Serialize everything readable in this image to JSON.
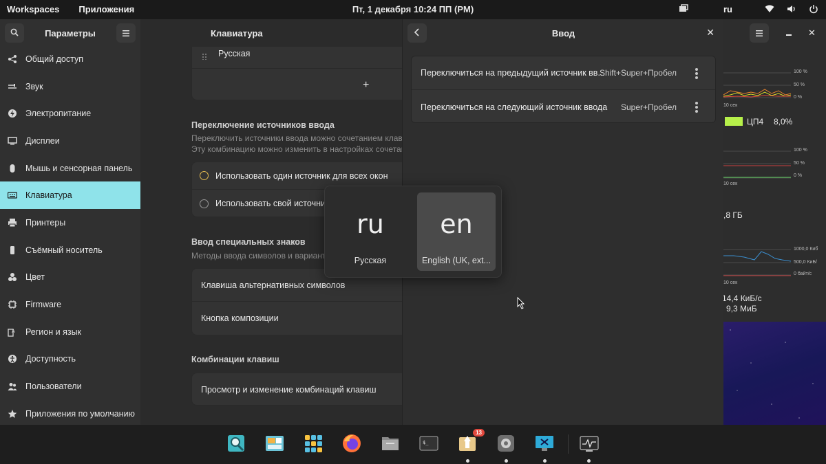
{
  "topbar": {
    "workspaces": "Workspaces",
    "applications": "Приложения",
    "datetime": "Пт, 1 декабря  10:24 ПП (PM)",
    "keyboard_layout": "ru"
  },
  "settings": {
    "sidebar_title": "Параметры",
    "main_title": "Клавиатура",
    "sidebar_items": [
      {
        "label": "Общий доступ",
        "icon": "share-icon"
      },
      {
        "label": "Звук",
        "icon": "sound-icon"
      },
      {
        "label": "Электропитание",
        "icon": "power-icon"
      },
      {
        "label": "Дисплеи",
        "icon": "display-icon"
      },
      {
        "label": "Мышь и сенсорная панель",
        "icon": "mouse-icon"
      },
      {
        "label": "Клавиатура",
        "icon": "keyboard-icon",
        "active": true
      },
      {
        "label": "Принтеры",
        "icon": "printer-icon"
      },
      {
        "label": "Съёмный носитель",
        "icon": "usb-icon"
      },
      {
        "label": "Цвет",
        "icon": "color-icon"
      },
      {
        "label": "Firmware",
        "icon": "chip-icon"
      },
      {
        "label": "Регион и язык",
        "icon": "region-icon"
      },
      {
        "label": "Доступность",
        "icon": "accessibility-icon"
      },
      {
        "label": "Пользователи",
        "icon": "users-icon"
      },
      {
        "label": "Приложения по умолчанию",
        "icon": "star-icon"
      }
    ],
    "input_sources": {
      "current": "Русская",
      "add_label": "+"
    },
    "switching": {
      "title": "Переключение источников ввода",
      "sub1": "Переключить источники ввода можно сочетанием клавиш",
      "sub2": "Эту комбинацию можно изменить в настройках сочетаний",
      "option1": "Использовать один источник для всех окон",
      "option2": "Использовать свой источник для каждого окна"
    },
    "special": {
      "title": "Ввод специальных знаков",
      "sub": "Методы ввода символов и вариантов букв с помощью клавиатуры",
      "row1": "Клавиша альтернативных символов",
      "row2": "Кнопка композиции"
    },
    "shortcuts": {
      "title": "Комбинации клавиш",
      "row1": "Просмотр и изменение комбинаций клавиш"
    }
  },
  "dialog": {
    "title": "Ввод",
    "rows": [
      {
        "label": "Переключиться на предыдущий источник вв...",
        "accel": "Shift+Super+Пробел"
      },
      {
        "label": "Переключиться на следующий источник ввода",
        "accel": "Super+Пробел"
      }
    ]
  },
  "switcher": {
    "items": [
      {
        "code": "ru",
        "name": "Русская"
      },
      {
        "code": "en",
        "name": "English (UK, ext..."
      }
    ]
  },
  "monitor": {
    "ticks1": [
      "100 %",
      "50 %",
      "0 %"
    ],
    "time1": "10 сек",
    "cpu_label": "ЦП4",
    "cpu_value": "8,0%",
    "ticks2": [
      "100 %",
      "50 %",
      "0 %"
    ],
    "time2": "10 сек",
    "mem_value": ",8 ГБ",
    "ticks3": [
      "1000,0 Киб",
      "500,0 КиБ/",
      "0 байт/с"
    ],
    "time3": "10 сек",
    "net_down": "14,4 КиБ/с",
    "net_up": "9,3 МиБ"
  },
  "dock": {
    "badge": "13"
  }
}
